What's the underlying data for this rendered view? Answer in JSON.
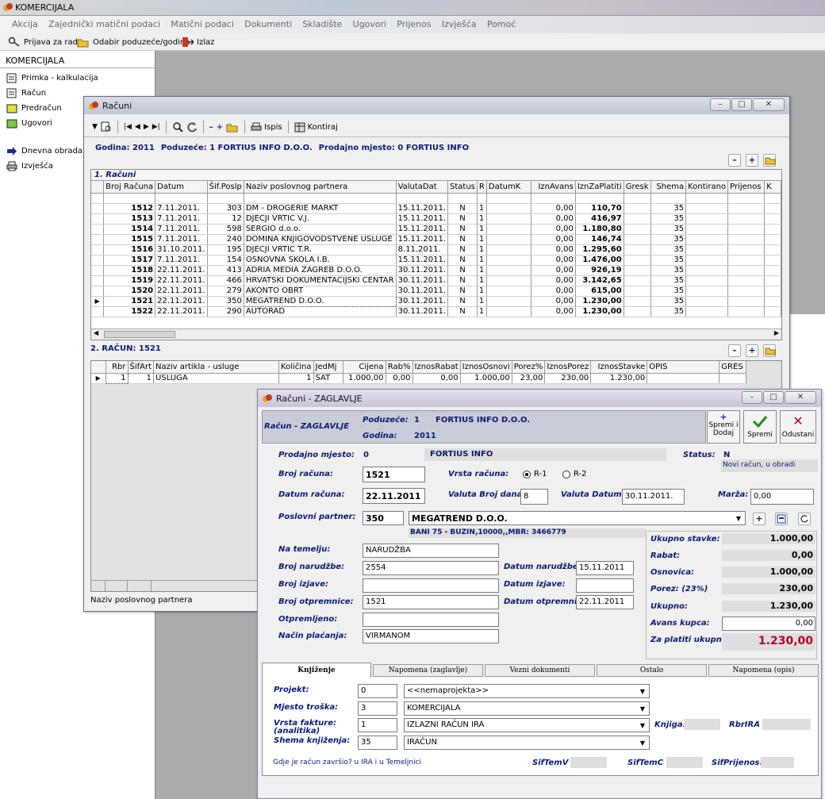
{
  "app": {
    "title": "KOMERCIJALA"
  },
  "menu": [
    "Akcija",
    "Zajednički matični podaci",
    "Matični podaci",
    "Dokumenti",
    "Skladište",
    "Ugovori",
    "Prijenos",
    "Izvješća",
    "Pomoć"
  ],
  "toolbar": {
    "login": "Prijava za rad",
    "select_company": "Odabir poduzeće/godina",
    "exit": "Izlaz"
  },
  "sidebar": {
    "header": "KOMERCIJALA",
    "items": [
      {
        "label": "Primka - kalkulacija",
        "icon": "document-icon"
      },
      {
        "label": "Račun",
        "icon": "document-icon"
      },
      {
        "label": "Predračun",
        "icon": "folder-icon"
      },
      {
        "label": "Ugovori",
        "icon": "folder-icon"
      },
      {
        "label": "Dnevna obrada računa",
        "icon": "arrow-right-icon"
      },
      {
        "label": "Izvješća",
        "icon": "printer-icon"
      }
    ]
  },
  "racuni": {
    "title": "Računi",
    "toolbar": {
      "print": "Ispis",
      "kontiraj": "Kontiraj"
    },
    "info": {
      "godina": "Godina: 2011",
      "poduzece": "Poduzeće: 1 FORTIUS INFO D.O.O.",
      "prodajno": "Prodajno mjesto: 0 FORTIUS INFO"
    },
    "section1": "1. Računi",
    "columns": [
      "Broj Računa",
      "Datum",
      "Šif.Poslp",
      "Naziv poslovnog partnera",
      "ValutaDat",
      "Status",
      "R",
      "DatumK",
      "IznAvans",
      "IznZaPlatiti",
      "Gresk",
      "Shema",
      "Kontirano",
      "Prijenos",
      "K"
    ],
    "rows": [
      [
        "1512",
        "7.11.2011.",
        "303",
        "DM - DROGERIE MARKT",
        "15.11.2011.",
        "N",
        "1",
        "",
        "0,00",
        "110,70",
        "",
        "35"
      ],
      [
        "1513",
        "7.11.2011.",
        "12",
        "DJEČJI VRTIĆ V.J.",
        "15.11.2011.",
        "N",
        "1",
        "",
        "0,00",
        "416,97",
        "",
        "35"
      ],
      [
        "1514",
        "7.11.2011.",
        "598",
        "SERGIO d.o.o.",
        "15.11.2011.",
        "N",
        "1",
        "",
        "0,00",
        "1.180,80",
        "",
        "35"
      ],
      [
        "1515",
        "7.11.2011.",
        "240",
        "DOMINA KNJIGOVODSTVENE USLUGE",
        "15.11.2011.",
        "N",
        "1",
        "",
        "0,00",
        "146,74",
        "",
        "35"
      ],
      [
        "1516",
        "31.10.2011.",
        "195",
        "DJEČJI VRTIĆ T.R.",
        "8.11.2011.",
        "N",
        "1",
        "",
        "0,00",
        "1.295,60",
        "",
        "35"
      ],
      [
        "1517",
        "7.11.2011.",
        "154",
        "OSNOVNA ŠKOLA I.B.",
        "15.11.2011.",
        "N",
        "1",
        "",
        "0,00",
        "1.476,00",
        "",
        "35"
      ],
      [
        "1518",
        "22.11.2011.",
        "413",
        "ADRIA MEDIA ZAGREB D.O.O.",
        "30.11.2011.",
        "N",
        "1",
        "",
        "0,00",
        "926,19",
        "",
        "35"
      ],
      [
        "1519",
        "22.11.2011.",
        "466",
        "HRVATSKI DOKUMENTACIJSKI CENTAR",
        "30.11.2011.",
        "N",
        "1",
        "",
        "0,00",
        "3.142,65",
        "",
        "35"
      ],
      [
        "1520",
        "22.11.2011.",
        "279",
        "AKONTO OBRT",
        "30.11.2011.",
        "N",
        "1",
        "",
        "0,00",
        "615,00",
        "",
        "35"
      ],
      [
        "1521",
        "22.11.2011.",
        "350",
        "MEGATREND D.O.O.",
        "30.11.2011.",
        "N",
        "1",
        "",
        "0,00",
        "1.230,00",
        "",
        "35"
      ],
      [
        "1522",
        "22.11.2011.",
        "290",
        "AUTORAD",
        "30.11.2011.",
        "N",
        "1",
        "",
        "0,00",
        "1.230,00",
        "",
        "35"
      ]
    ],
    "section2": "2. RAČUN: 1521",
    "items_columns": [
      "Rbr",
      "ŠifArt",
      "Naziv artikla - usluge",
      "Količina",
      "JedMj",
      "Cijena",
      "Rab%",
      "IznosRabat",
      "IznosOsnovi",
      "Porez%",
      "IznosPorez",
      "IznosStavke",
      "OPIS",
      "GRES"
    ],
    "items_rows": [
      [
        "1",
        "1",
        "USLUGA",
        "1",
        "SAT",
        "1.000,00",
        "0,00",
        "0,00",
        "1.000,00",
        "23,00",
        "230,00",
        "1.230,00",
        "",
        ""
      ]
    ],
    "status_bar": "Naziv poslovnog partnera"
  },
  "zaglavlje": {
    "title": "Računi - ZAGLAVLJE",
    "header": {
      "label": "Račun - ZAGLAVLJE",
      "poduzece_label": "Poduzeće:",
      "poduzece_id": "1",
      "poduzece_name": "FORTIUS INFO D.O.O.",
      "godina_label": "Godina:",
      "godina": "2011"
    },
    "buttons": {
      "save_add": "Spremi i Dodaj",
      "save": "Spremi",
      "cancel": "Odustani"
    },
    "prodajno": {
      "label": "Prodajno mjesto:",
      "id": "0",
      "name": "FORTIUS INFO"
    },
    "status": {
      "label": "Status:",
      "value": "N",
      "desc": "Novi račun, u obradi"
    },
    "broj_racuna": {
      "label": "Broj računa:",
      "value": "1521"
    },
    "vrsta_racuna": {
      "label": "Vrsta računa:",
      "opt1": "R-1",
      "opt2": "R-2",
      "selected": "R-1"
    },
    "datum_racuna": {
      "label": "Datum računa:",
      "value": "22.11.2011"
    },
    "valuta_broj_dana": {
      "label": "Valuta Broj dana:",
      "value": "8"
    },
    "valuta_datum": {
      "label": "Valuta Datum:",
      "value": "30.11.2011."
    },
    "marza": {
      "label": "Marža:",
      "value": "0,00"
    },
    "partner": {
      "label": "Poslovni partner:",
      "id": "350",
      "name": "MEGATREND D.O.O.",
      "address": "BANI 75 - BUZIN,10000,,MBR: 3466779"
    },
    "na_temelju": {
      "label": "Na temelju:",
      "value": "NARUDŽBA"
    },
    "broj_narudzbe": {
      "label": "Broj narudžbe:",
      "value": "2554"
    },
    "datum_narudzbe": {
      "label": "Datum narudžbe:",
      "value": "15.11.2011"
    },
    "broj_izjave": {
      "label": "Broj izjave:",
      "value": ""
    },
    "datum_izjave": {
      "label": "Datum izjave:",
      "value": ""
    },
    "broj_otpremnice": {
      "label": "Broj otpremnice:",
      "value": "1521"
    },
    "datum_otpremnice": {
      "label": "Datum otpremnice:",
      "value": "22.11.2011"
    },
    "otpremljeno": {
      "label": "Otpremljeno:",
      "value": ""
    },
    "nacin_placanja": {
      "label": "Način plaćanja:",
      "value": "VIRMANOM"
    },
    "totals": {
      "ukupno_stavke": {
        "label": "Ukupno stavke:",
        "value": "1.000,00"
      },
      "rabat": {
        "label": "Rabat:",
        "value": "0,00"
      },
      "osnovica": {
        "label": "Osnovica:",
        "value": "1.000,00"
      },
      "porez": {
        "label": "Porez: (23%)",
        "value": "230,00"
      },
      "ukupno": {
        "label": "Ukupno:",
        "value": "1.230,00"
      },
      "avans": {
        "label": "Avans kupca:",
        "value": "0,00"
      },
      "za_platiti": {
        "label": "Za platiti ukupno:",
        "value": "1.230,00"
      }
    },
    "tabs": [
      "Knjiženje",
      "Napomena (zaglavlje)",
      "Vezni dokumenti",
      "Ostalo",
      "Napomena (opis)"
    ],
    "knjizenje": {
      "projekt": {
        "label": "Projekt:",
        "id": "0",
        "name": "<<nemaprojekta>>"
      },
      "mjesto_troska": {
        "label": "Mjesto troška:",
        "id": "3",
        "name": "KOMERCIJALA"
      },
      "vrsta_fakture": {
        "label": "Vrsta fakture: (analitika)",
        "id": "1",
        "name": "IZLAZNI RAČUN IRA"
      },
      "shema": {
        "label": "Shema knjiženja:",
        "id": "35",
        "name": "IRAČUN"
      },
      "knjiga_label": "Knjiga:",
      "rbrira_label": "RbrIRA",
      "footer_link": "Gdje je račun završio? u IRA i u Temeljnici",
      "siftemv": "SifTemV",
      "siftemc": "SifTemC",
      "sifprijenos": "SifPrijenos:"
    }
  },
  "colors": {
    "label_blue": "#0b1c6e",
    "total_red": "#b0002a",
    "selected_row": "#fff"
  }
}
